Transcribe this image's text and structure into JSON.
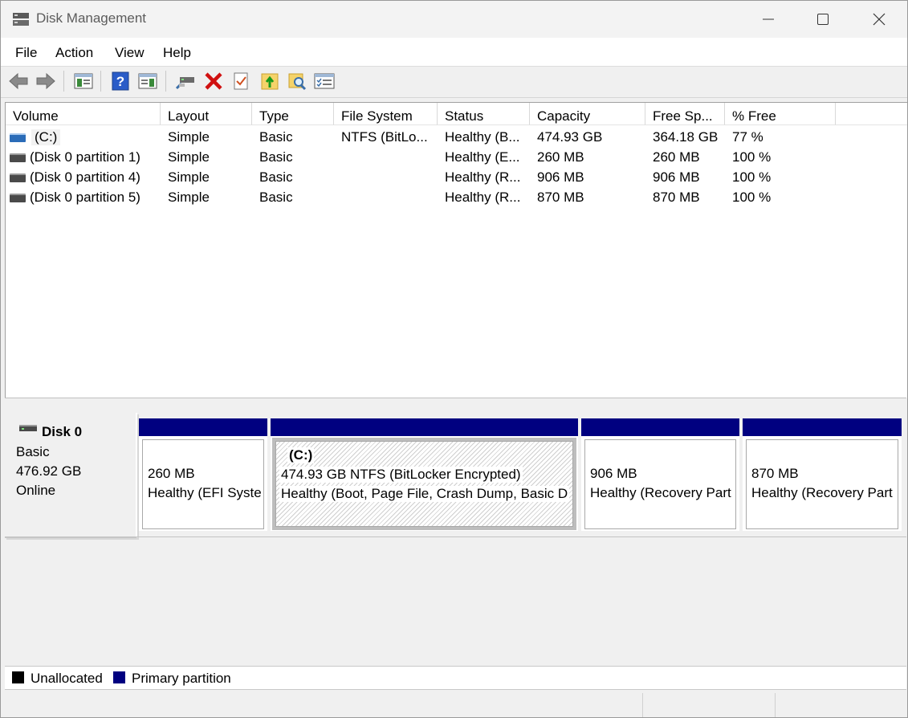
{
  "window": {
    "title": "Disk Management",
    "app_icon": "disk-management-icon",
    "controls": [
      "minimize-icon",
      "maximize-icon",
      "close-icon"
    ]
  },
  "menu": [
    "File",
    "Action",
    "View",
    "Help"
  ],
  "toolbar": {
    "buttons": [
      "back-icon",
      "forward-icon",
      "show-hide-console-tree-icon",
      "help-icon",
      "show-hide-action-pane-icon",
      "connect-virtual-disk-icon",
      "delete-icon",
      "check-icon",
      "import-icon",
      "search-icon",
      "properties-icon"
    ]
  },
  "volume_list": {
    "columns": [
      "Volume",
      "Layout",
      "Type",
      "File System",
      "Status",
      "Capacity",
      "Free Sp...",
      "% Free"
    ],
    "rows": [
      {
        "volume": "(C:)",
        "layout": "Simple",
        "type": "Basic",
        "fs": "NTFS (BitLo...",
        "status": "Healthy (B...",
        "capacity": "474.93 GB",
        "free": "364.18 GB",
        "pct": "77 %"
      },
      {
        "volume": "(Disk 0 partition 1)",
        "layout": "Simple",
        "type": "Basic",
        "fs": "",
        "status": "Healthy (E...",
        "capacity": "260 MB",
        "free": "260 MB",
        "pct": "100 %"
      },
      {
        "volume": "(Disk 0 partition 4)",
        "layout": "Simple",
        "type": "Basic",
        "fs": "",
        "status": "Healthy (R...",
        "capacity": "906 MB",
        "free": "906 MB",
        "pct": "100 %"
      },
      {
        "volume": "(Disk 0 partition 5)",
        "layout": "Simple",
        "type": "Basic",
        "fs": "",
        "status": "Healthy (R...",
        "capacity": "870 MB",
        "free": "870 MB",
        "pct": "100 %"
      }
    ]
  },
  "disk": {
    "name": "Disk 0",
    "type": "Basic",
    "size": "476.92 GB",
    "state": "Online",
    "partitions": [
      {
        "label": "",
        "line1": "260 MB",
        "line2": "Healthy (EFI Syste"
      },
      {
        "label": "(C:)",
        "line1": "474.93 GB NTFS (BitLocker Encrypted)",
        "line2": "Healthy (Boot, Page File, Crash Dump, Basic D"
      },
      {
        "label": "",
        "line1": "906 MB",
        "line2": "Healthy (Recovery Part"
      },
      {
        "label": "",
        "line1": "870 MB",
        "line2": "Healthy (Recovery Part"
      }
    ]
  },
  "legend": [
    {
      "label": "Unallocated",
      "color": "#000000"
    },
    {
      "label": "Primary partition",
      "color": "#000080"
    }
  ],
  "colors": {
    "primary_partition": "#000080",
    "system_volume_icon": "#2b6cb8"
  }
}
